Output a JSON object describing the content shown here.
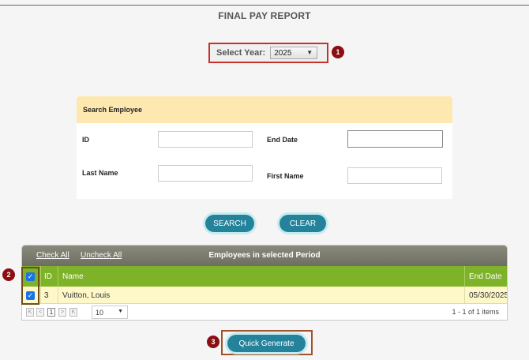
{
  "page": {
    "title": "FINAL PAY REPORT"
  },
  "year": {
    "label": "Select Year:",
    "value": "2025"
  },
  "badges": {
    "one": "1",
    "two": "2",
    "three": "3"
  },
  "search": {
    "header": "Search Employee",
    "id_label": "ID",
    "end_date_label": "End Date",
    "last_name_label": "Last Name",
    "first_name_label": "First Name",
    "id_value": "",
    "end_date_value": "",
    "last_name_value": "",
    "first_name_value": ""
  },
  "buttons": {
    "search": "SEARCH",
    "clear": "CLEAR",
    "quick_generate": "Quick Generate"
  },
  "grid": {
    "check_all": "Check All",
    "uncheck_all": "Uncheck All",
    "caption": "Employees in selected Period",
    "columns": {
      "id": "ID",
      "name": "Name",
      "end_date": "End Date"
    },
    "rows": [
      {
        "id": "3",
        "name": "Vuitton, Louis",
        "end_date": "05/30/2025",
        "checked": true
      }
    ],
    "pager": {
      "first": "K",
      "prev": "<",
      "page": "1",
      "next": ">",
      "last": "K",
      "page_size": "10",
      "info": "1 - 1 of 1 items"
    }
  },
  "colors": {
    "accent": "#24829a",
    "highlight": "#c9302c",
    "badge": "#8b0f12",
    "grid_header": "#7db229",
    "search_header": "#fde9b0",
    "row_bg": "#fef7c8"
  },
  "icons": {
    "checkbox": "checkmark-icon",
    "caret": "chevron-down-icon"
  }
}
